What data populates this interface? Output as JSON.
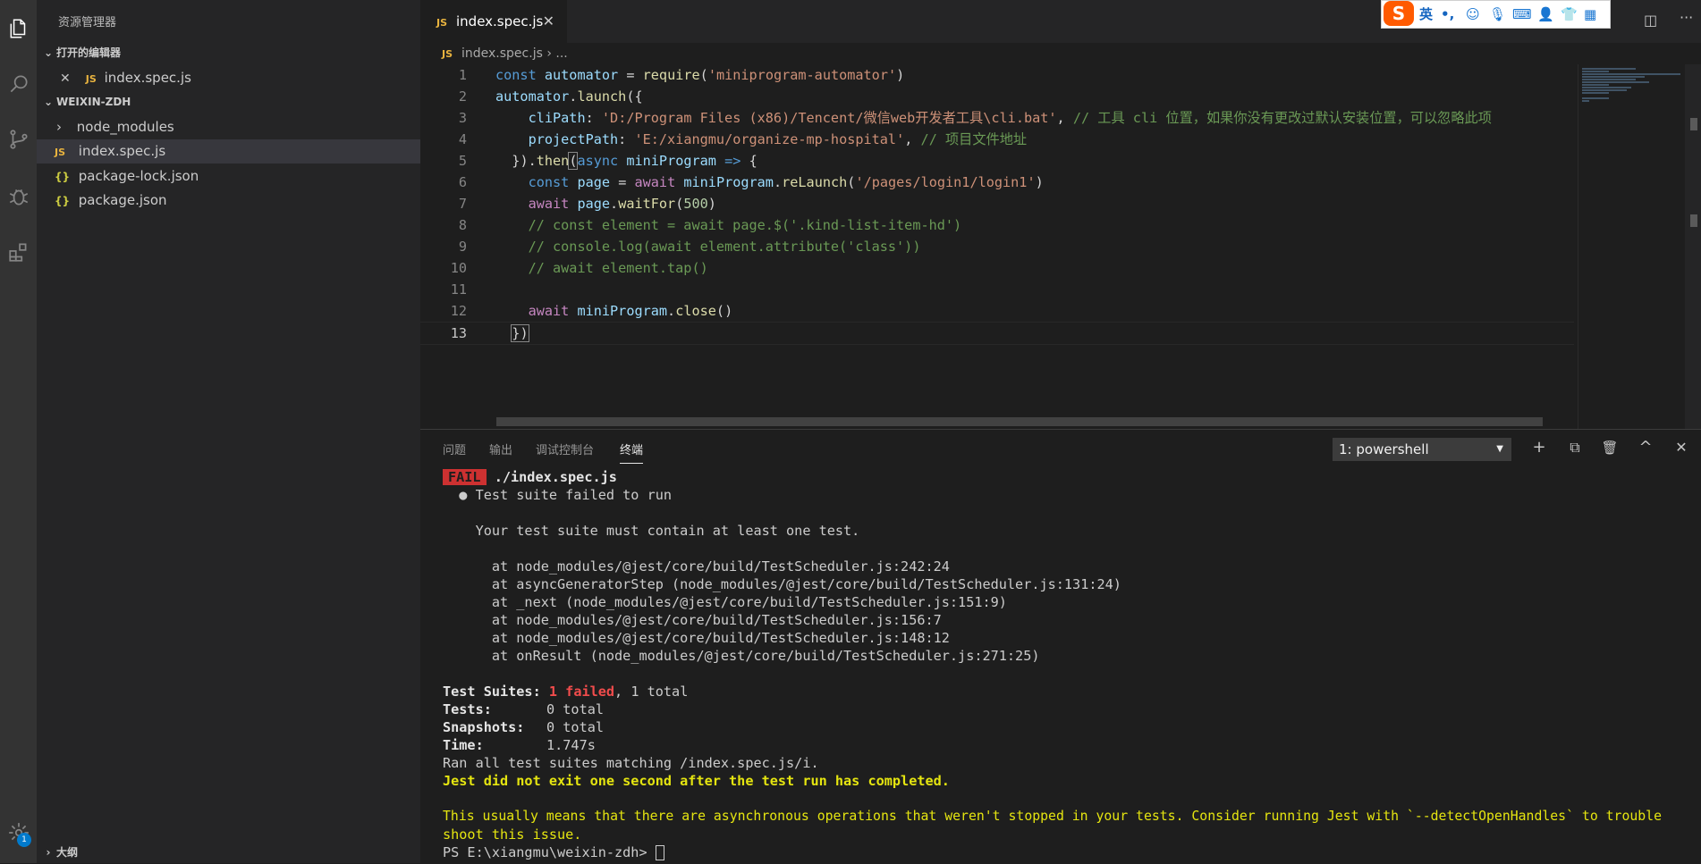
{
  "sidebar": {
    "title": "资源管理器",
    "open_editors_header": "打开的编辑器",
    "open_editors": [
      {
        "icon": "JS",
        "name": "index.spec.js"
      }
    ],
    "folder_header": "WEIXIN-ZDH",
    "files": [
      {
        "icon": "chevron-right",
        "name": "node_modules"
      },
      {
        "icon": "JS",
        "name": "index.spec.js"
      },
      {
        "icon": "{}",
        "name": "package-lock.json"
      },
      {
        "icon": "{}",
        "name": "package.json"
      }
    ],
    "outline_header": "大纲"
  },
  "activity": {
    "settings_badge": "1"
  },
  "editor": {
    "tab": {
      "icon": "JS",
      "label": "index.spec.js",
      "close": "✕"
    },
    "breadcrumb": {
      "icon": "JS",
      "file": "index.spec.js",
      "sep": "›",
      "rest": "..."
    },
    "line_numbers": [
      "1",
      "2",
      "3",
      "4",
      "5",
      "6",
      "7",
      "8",
      "9",
      "10",
      "11",
      "12",
      "13"
    ],
    "code": {
      "l1": [
        "const",
        "automator",
        "=",
        "require",
        "(",
        "'miniprogram-automator'",
        ")"
      ],
      "l2": [
        "automator",
        ".",
        "launch",
        "({"
      ],
      "l3": [
        "cliPath",
        ":",
        "'D:/Program Files (x86)/Tencent/微信web开发者工具\\cli.bat'",
        ",",
        "// 工具 cli 位置，如果你没有更改过默认安装位置，可以忽略此项"
      ],
      "l4": [
        "projectPath",
        ":",
        "'E:/xiangmu/organize-mp-hospital'",
        ",",
        "// 项目文件地址"
      ],
      "l5": [
        "})",
        ".",
        "then",
        "(",
        "async",
        "miniProgram",
        "=>",
        "{"
      ],
      "l6": [
        "const",
        "page",
        "=",
        "await",
        "miniProgram",
        ".",
        "reLaunch",
        "(",
        "'/pages/login1/login1'",
        ")"
      ],
      "l7": [
        "await",
        "page",
        ".",
        "waitFor",
        "(",
        "500",
        ")"
      ],
      "l8": [
        "// const element = await page.$('.kind-list-item-hd')"
      ],
      "l9": [
        "// console.log(await element.attribute('class'))"
      ],
      "l10": [
        "// await element.tap()"
      ],
      "l12": [
        "await",
        "miniProgram",
        ".",
        "close",
        "()"
      ],
      "l13": [
        "})"
      ]
    }
  },
  "panel": {
    "tabs": [
      "问题",
      "输出",
      "调试控制台",
      "终端"
    ],
    "terminal_select": "1: powershell",
    "buttons": {
      "add": "+",
      "split": "⧉",
      "trash": "🗑",
      "maximize": "^",
      "close": "✕"
    },
    "terminal": {
      "fail_badge": "FAIL",
      "fail_file": "./index.spec.js",
      "l2": "  ● Test suite failed to run",
      "l4": "    Your test suite must contain at least one test.",
      "stack": [
        "      at node_modules/@jest/core/build/TestScheduler.js:242:24",
        "      at asyncGeneratorStep (node_modules/@jest/core/build/TestScheduler.js:131:24)",
        "      at _next (node_modules/@jest/core/build/TestScheduler.js:151:9)",
        "      at node_modules/@jest/core/build/TestScheduler.js:156:7",
        "      at node_modules/@jest/core/build/TestScheduler.js:148:12",
        "      at onResult (node_modules/@jest/core/build/TestScheduler.js:271:25)"
      ],
      "suites_label": "Test Suites:",
      "suites_failed": "1 failed",
      "suites_rest": ", 1 total",
      "tests_label": "Tests:",
      "tests_value": "0 total",
      "snapshots_label": "Snapshots:",
      "snapshots_value": "0 total",
      "time_label": "Time:",
      "time_value": "1.747s",
      "ran": "Ran all test suites matching /index.spec.js/i.",
      "jest_exit": "Jest did not exit one second after the test run has completed.",
      "usually1": "This usually means that there are asynchronous operations that weren't stopped in your tests. Consider running Jest with `--detectOpenHandles` to trouble",
      "usually2": "shoot this issue.",
      "prompt": "PS E:\\xiangmu\\weixin-zdh> "
    }
  },
  "ime": {
    "logo": "S",
    "lang": "英",
    "punct": "•,"
  }
}
